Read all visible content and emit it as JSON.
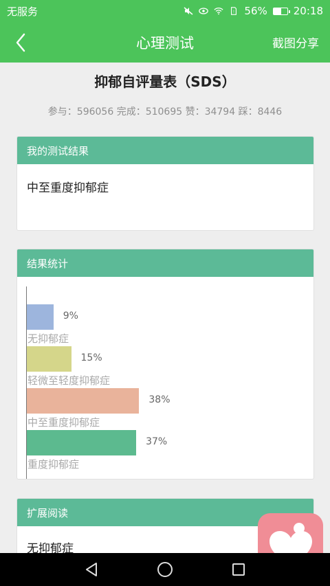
{
  "status_bar": {
    "carrier": "无服务",
    "battery_percent": "56%",
    "battery_level": 0.56,
    "time": "20:18"
  },
  "app_bar": {
    "title": "心理测试",
    "share_label": "截图分享"
  },
  "test": {
    "title": "抑郁自评量表（SDS）",
    "stats": "参与：596056 完成：510695 赞：34794 踩：8446"
  },
  "result_card": {
    "header": "我的测试结果",
    "result": "中至重度抑郁症"
  },
  "stats_card": {
    "header": "结果统计"
  },
  "chart_data": {
    "type": "bar",
    "orientation": "horizontal",
    "categories": [
      "无抑郁症",
      "轻微至轻度抑郁症",
      "中至重度抑郁症",
      "重度抑郁症"
    ],
    "values": [
      9,
      15,
      38,
      37
    ],
    "value_labels": [
      "9%",
      "15%",
      "38%",
      "37%"
    ],
    "colors": [
      "#9db5dd",
      "#d5d68a",
      "#e9b39b",
      "#5cba8f"
    ],
    "unit": "%"
  },
  "ext_card": {
    "header": "扩展阅读",
    "items": [
      "无抑郁症"
    ]
  }
}
